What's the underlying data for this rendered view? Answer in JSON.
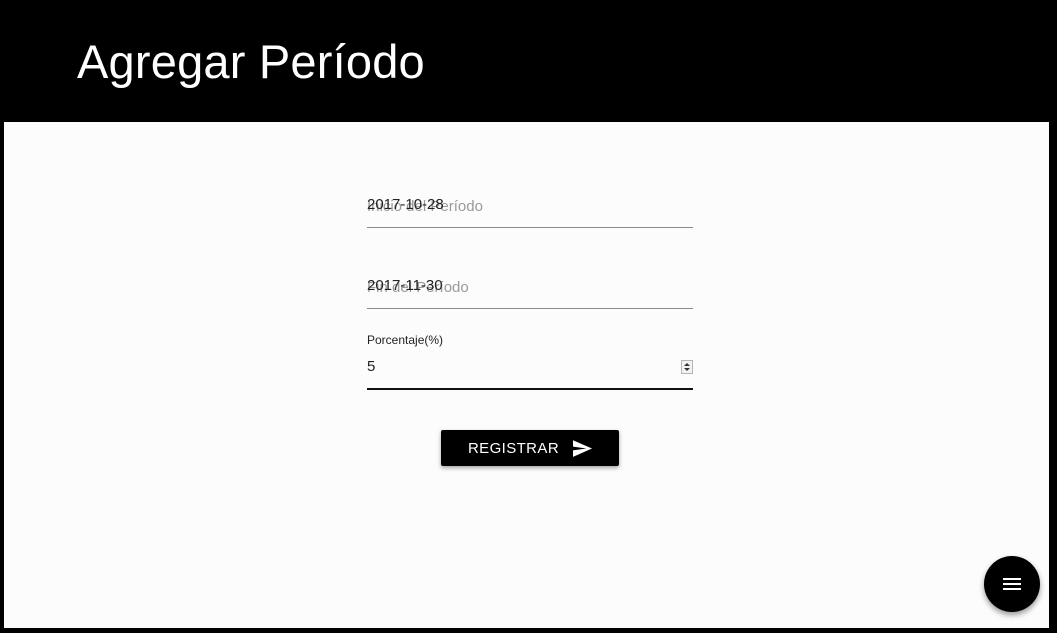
{
  "header": {
    "title": "Agregar Período"
  },
  "form": {
    "start_date": {
      "value": "2017-10-28",
      "placeholder": "Inicio del Período"
    },
    "end_date": {
      "value": "2017-11-30",
      "placeholder": "Fin del Período"
    },
    "percentage": {
      "label": "Porcentaje(%)",
      "value": "5"
    },
    "submit_label": "REGISTRAR",
    "submit_icon": "send-icon"
  },
  "fab": {
    "icon": "menu-icon"
  },
  "colors": {
    "header_bg": "#000000",
    "content_bg": "#fcfcfc",
    "button_bg": "#000000",
    "button_text": "#ffffff"
  }
}
